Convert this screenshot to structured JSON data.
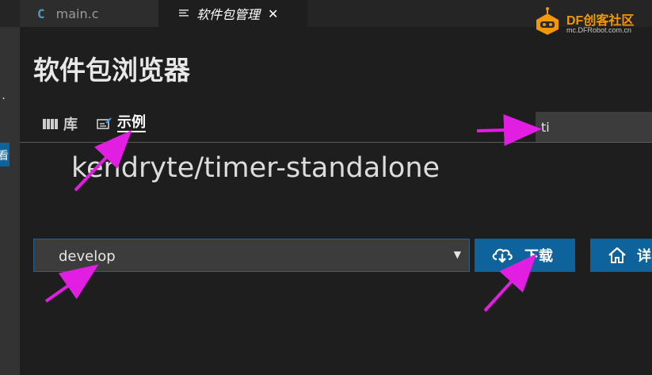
{
  "tabs": [
    {
      "icon": "c-file-icon",
      "glyph": "C",
      "label": "main.c"
    },
    {
      "icon": "document-icon",
      "label": "软件包管理",
      "close": "✕"
    }
  ],
  "activity": {
    "dot": ".",
    "chip": "看"
  },
  "logo": {
    "brand": "DF创客社区",
    "url": "mc.DFRobot.com.cn"
  },
  "page": {
    "title": "软件包浏览器",
    "subtabs": [
      {
        "icon": "library-icon",
        "label": "库"
      },
      {
        "icon": "example-icon",
        "label": "示例",
        "active": true
      }
    ],
    "search": {
      "value": "ti"
    },
    "package_name": "kendryte/timer-standalone",
    "version_select": {
      "selected": "develop",
      "caret": "▼"
    },
    "buttons": {
      "download": "下载",
      "detail": "详"
    }
  },
  "annotation_color": "#e21ee2"
}
